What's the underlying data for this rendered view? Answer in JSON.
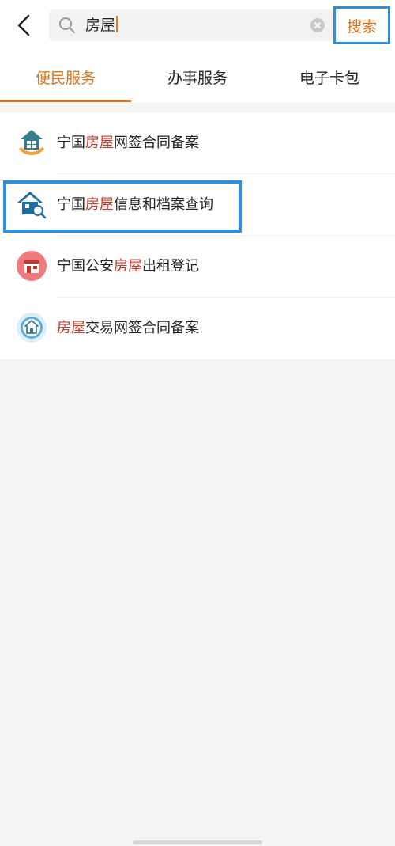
{
  "search": {
    "query": "房屋",
    "button_label": "搜索"
  },
  "tabs": [
    {
      "label": "便民服务",
      "active": true
    },
    {
      "label": "办事服务",
      "active": false
    },
    {
      "label": "电子卡包",
      "active": false
    }
  ],
  "results": [
    {
      "icon": "house-hands-icon",
      "prefix": "宁国",
      "highlight": "房屋",
      "suffix": "网签合同备案"
    },
    {
      "icon": "house-search-icon",
      "prefix": "宁国",
      "highlight": "房屋",
      "suffix": "信息和档案查询"
    },
    {
      "icon": "store-icon",
      "prefix": "宁国公安",
      "highlight": "房屋",
      "suffix": "出租登记"
    },
    {
      "icon": "home-circle-icon",
      "prefix": "",
      "highlight": "房屋",
      "suffix": "交易网签合同备案"
    }
  ],
  "colors": {
    "accent": "#d9741c",
    "highlight_text": "#c0392b",
    "annotation": "#2f8fdc"
  }
}
